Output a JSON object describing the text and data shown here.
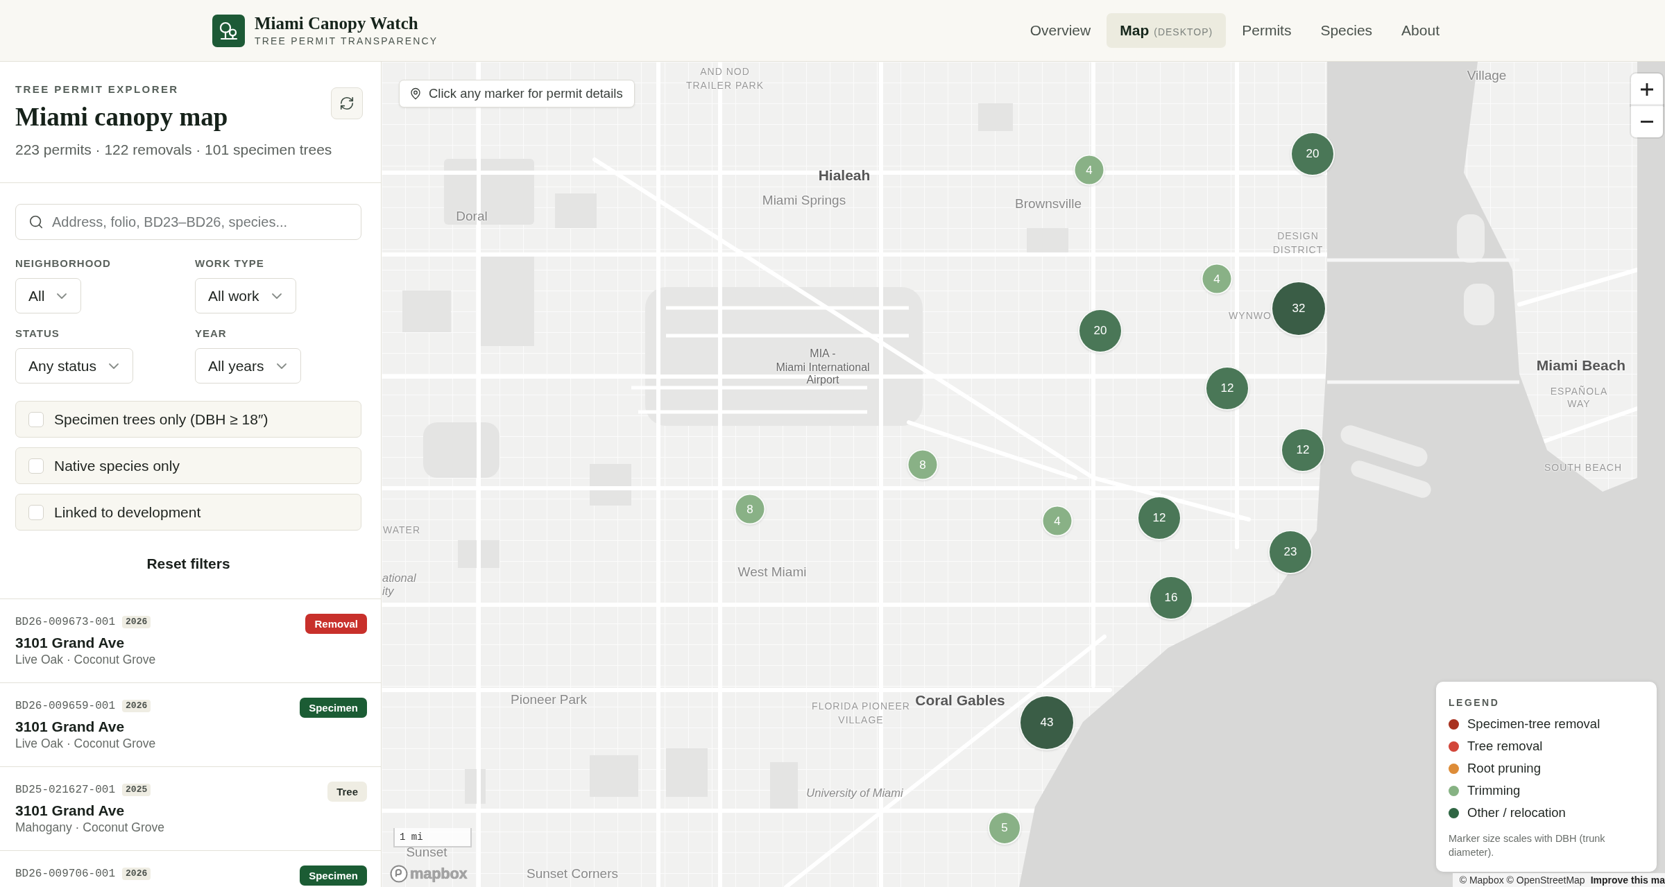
{
  "header": {
    "brand": {
      "title": "Miami Canopy Watch",
      "subtitle": "TREE PERMIT TRANSPARENCY"
    },
    "nav": [
      {
        "label": "Overview",
        "selected": false
      },
      {
        "label": "Map",
        "note": "(DESKTOP)",
        "selected": true
      },
      {
        "label": "Permits",
        "selected": false
      },
      {
        "label": "Species",
        "selected": false
      },
      {
        "label": "About",
        "selected": false
      }
    ]
  },
  "sidebar": {
    "eyebrow": "TREE PERMIT EXPLORER",
    "title": "Miami canopy map",
    "stats": "223 permits · 122 removals · 101 specimen trees",
    "search": {
      "placeholder": "Address, folio, BD23–BD26, species..."
    },
    "filters": [
      {
        "label": "NEIGHBORHOOD",
        "value": "All"
      },
      {
        "label": "WORK TYPE",
        "value": "All work"
      },
      {
        "label": "STATUS",
        "value": "Any status"
      },
      {
        "label": "YEAR",
        "value": "All years"
      }
    ],
    "toggles": [
      {
        "label": "Specimen trees only (DBH ≥ 18″)",
        "checked": false
      },
      {
        "label": "Native species only",
        "checked": false
      },
      {
        "label": "Linked to development",
        "checked": false
      }
    ],
    "reset": "Reset filters",
    "permits": [
      {
        "id": "BD26-009673-001",
        "year": "2026",
        "badge": {
          "label": "Removal",
          "kind": "removal"
        },
        "address": "3101 Grand Ave",
        "detail": "Live Oak · Coconut Grove"
      },
      {
        "id": "BD26-009659-001",
        "year": "2026",
        "badge": {
          "label": "Specimen",
          "kind": "specimen"
        },
        "address": "3101 Grand Ave",
        "detail": "Live Oak · Coconut Grove"
      },
      {
        "id": "BD25-021627-001",
        "year": "2025",
        "badge": {
          "label": "Tree",
          "kind": "tree"
        },
        "address": "3101 Grand Ave",
        "detail": "Mahogany · Coconut Grove"
      },
      {
        "id": "BD26-009706-001",
        "year": "2026",
        "badge": {
          "label": "Specimen",
          "kind": "specimen"
        }
      }
    ]
  },
  "map": {
    "hint": "Click any marker for permit details",
    "place_labels": [
      {
        "text": "AND NOD",
        "kind": "district"
      },
      {
        "text": "TRAILER PARK",
        "kind": "district"
      },
      {
        "text": "Village",
        "kind": "town"
      },
      {
        "text": "Hialeah",
        "kind": "city"
      },
      {
        "text": "Miami Springs",
        "kind": "town"
      },
      {
        "text": "Doral",
        "kind": "town"
      },
      {
        "text": "Brownsville",
        "kind": "town"
      },
      {
        "text": "DESIGN",
        "kind": "district"
      },
      {
        "text": "DISTRICT",
        "kind": "district"
      },
      {
        "text": "WYNWO",
        "kind": "district"
      },
      {
        "text": "MIA -",
        "kind": "poi"
      },
      {
        "text": "Miami International",
        "kind": "poi"
      },
      {
        "text": "Airport",
        "kind": "poi"
      },
      {
        "text": "Miami Beach",
        "kind": "city"
      },
      {
        "text": "ESPAÑOLA",
        "kind": "district"
      },
      {
        "text": "WAY",
        "kind": "district"
      },
      {
        "text": "SOUTH BEACH",
        "kind": "district"
      },
      {
        "text": "WATER",
        "kind": "district"
      },
      {
        "text": "ational",
        "kind": "institution"
      },
      {
        "text": "ity",
        "kind": "institution"
      },
      {
        "text": "West Miami",
        "kind": "town"
      },
      {
        "text": "Pioneer Park",
        "kind": "town"
      },
      {
        "text": "FLORIDA PIONEER",
        "kind": "district"
      },
      {
        "text": "VILLAGE",
        "kind": "district"
      },
      {
        "text": "Coral Gables",
        "kind": "city"
      },
      {
        "text": "University of Miami",
        "kind": "institution"
      },
      {
        "text": "Sunset",
        "kind": "town"
      },
      {
        "text": "Sunset Corners",
        "kind": "town"
      }
    ],
    "markers": [
      {
        "count": "4",
        "kind": "trimming"
      },
      {
        "count": "20",
        "kind": "other"
      },
      {
        "count": "4",
        "kind": "trimming"
      },
      {
        "count": "32",
        "kind": "other"
      },
      {
        "count": "20",
        "kind": "other"
      },
      {
        "count": "12",
        "kind": "other"
      },
      {
        "count": "12",
        "kind": "other"
      },
      {
        "count": "8",
        "kind": "trimming"
      },
      {
        "count": "8",
        "kind": "trimming"
      },
      {
        "count": "4",
        "kind": "trimming"
      },
      {
        "count": "12",
        "kind": "other"
      },
      {
        "count": "23",
        "kind": "other"
      },
      {
        "count": "16",
        "kind": "other"
      },
      {
        "count": "43",
        "kind": "other"
      },
      {
        "count": "5",
        "kind": "trimming"
      }
    ],
    "legend": {
      "title": "LEGEND",
      "items": [
        {
          "label": "Specimen-tree removal",
          "color": "#a8321f"
        },
        {
          "label": "Tree removal",
          "color": "#d2463a"
        },
        {
          "label": "Root pruning",
          "color": "#dd8c38"
        },
        {
          "label": "Trimming",
          "color": "#86b283"
        },
        {
          "label": "Other / relocation",
          "color": "#2f6643"
        }
      ],
      "note": "Marker size scales with DBH (trunk diameter)."
    },
    "scale": "1 mi",
    "logo": "mapbox",
    "attribution": {
      "text": "© Mapbox © OpenStreetMap",
      "link": "Improve this ma"
    }
  }
}
